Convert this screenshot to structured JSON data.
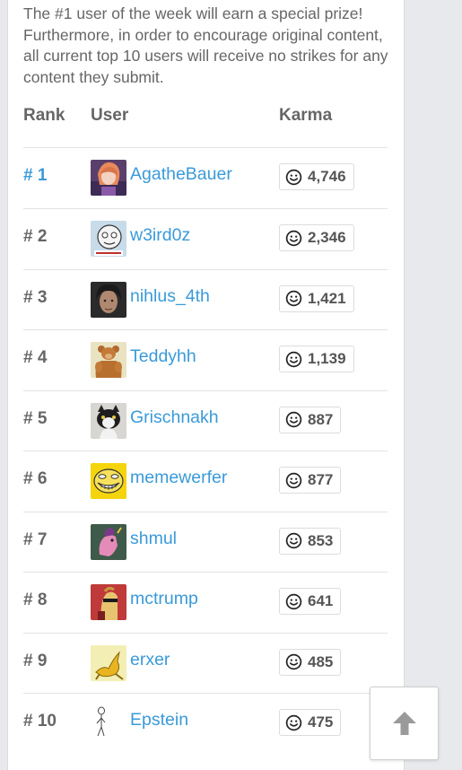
{
  "intro_text": "The #1 user of the week will earn a special prize! Furthermore, in order to encourage original content, all current top 10 users will receive no strikes for any content they submit.",
  "table": {
    "headers": {
      "rank": "Rank",
      "user": "User",
      "karma": "Karma"
    },
    "rows": [
      {
        "rank": "# 1",
        "user": "AgatheBauer",
        "karma": "4,746",
        "avatar_icon": "anime-character-avatar"
      },
      {
        "rank": "# 2",
        "user": "w3ird0z",
        "karma": "2,346",
        "avatar_icon": "cartoon-face-avatar"
      },
      {
        "rank": "# 3",
        "user": "nihlus_4th",
        "karma": "1,421",
        "avatar_icon": "dark-hair-man-avatar"
      },
      {
        "rank": "# 4",
        "user": "Teddyhh",
        "karma": "1,139",
        "avatar_icon": "muscular-teddy-bear-avatar"
      },
      {
        "rank": "# 5",
        "user": "Grischnakh",
        "karma": "887",
        "avatar_icon": "cat-avatar"
      },
      {
        "rank": "# 6",
        "user": "memewerfer",
        "karma": "877",
        "avatar_icon": "trollface-avatar"
      },
      {
        "rank": "# 7",
        "user": "shmul",
        "karma": "853",
        "avatar_icon": "pink-pony-avatar"
      },
      {
        "rank": "# 8",
        "user": "mctrump",
        "karma": "641",
        "avatar_icon": "sunglasses-horse-avatar"
      },
      {
        "rank": "# 9",
        "user": "erxer",
        "karma": "485",
        "avatar_icon": "yellow-kangaroo-avatar"
      },
      {
        "rank": "# 10",
        "user": "Epstein",
        "karma": "475",
        "avatar_icon": "stick-figure-avatar"
      }
    ]
  },
  "karma_icon": "smiley-icon",
  "scroll_top_icon": "arrow-up-icon",
  "colors": {
    "link": "#3a9ad9",
    "text": "#666666",
    "background": "#e8e9ec"
  }
}
